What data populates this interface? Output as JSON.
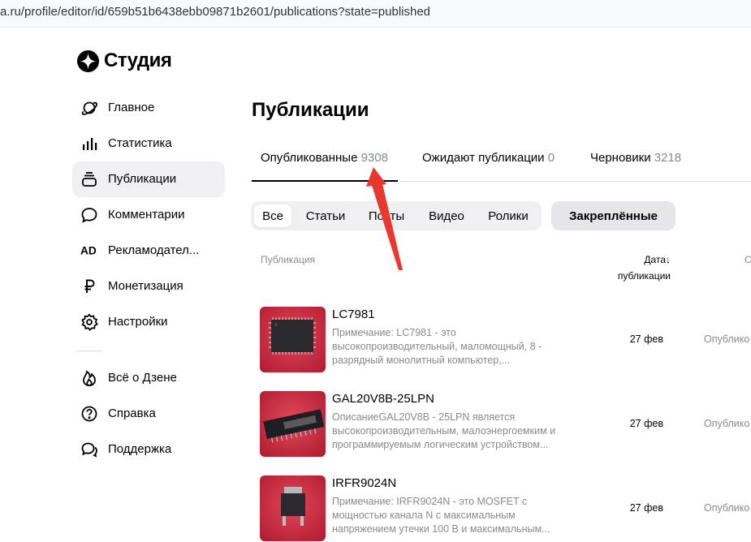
{
  "browser": {
    "url": "a.ru/profile/editor/id/659b51b6438ebb09871b2601/publications?state=published"
  },
  "brand": {
    "name": "Студия"
  },
  "sidebar": {
    "items": [
      {
        "label": "Главное",
        "icon": "planet-icon"
      },
      {
        "label": "Статистика",
        "icon": "bar-chart-icon"
      },
      {
        "label": "Публикации",
        "icon": "publications-icon",
        "active": true
      },
      {
        "label": "Комментарии",
        "icon": "comment-icon"
      },
      {
        "label": "Рекламодател...",
        "icon": "ad-icon"
      },
      {
        "label": "Монетизация",
        "icon": "ruble-icon"
      },
      {
        "label": "Настройки",
        "icon": "gear-icon"
      }
    ],
    "footer_items": [
      {
        "label": "Всё о Дзене",
        "icon": "flame-icon"
      },
      {
        "label": "Справка",
        "icon": "help-icon"
      },
      {
        "label": "Поддержка",
        "icon": "support-chat-icon"
      }
    ]
  },
  "page": {
    "title": "Публикации"
  },
  "tabs": [
    {
      "label": "Опубликованные",
      "count": "9308",
      "active": true
    },
    {
      "label": "Ожидают публикации",
      "count": "0"
    },
    {
      "label": "Черновики",
      "count": "3218"
    }
  ],
  "filters": {
    "types": [
      "Все",
      "Статьи",
      "Посты",
      "Видео",
      "Ролики"
    ],
    "selected": "Все",
    "pinned_label": "Закреплённые"
  },
  "table": {
    "col_publication": "Публикация",
    "col_date_line1": "Дата↓",
    "col_date_line2": "публикации",
    "col_status_partial": "С",
    "rows": [
      {
        "title": "LC7981",
        "desc": "Примечание: LC7981 - это высокопроизводительный, маломощный, 8 - разрядный монолитный компьютер,...",
        "date": "27 фев",
        "status": "Опублико"
      },
      {
        "title": "GAL20V8B-25LPN",
        "desc": "ОписаниеGAL20V8B - 25LPN является высокопроизводительным, малоэнергоемким и программируемым логическим устройством...",
        "date": "27 фев",
        "status": "Опублико"
      },
      {
        "title": "IRFR9024N",
        "desc": "Примечание: IRFR9024N - это MOSFET с мощностью канала N с максимальным напряжением утечки 100 В и максимальным...",
        "date": "27 фев",
        "status": "Опублико"
      }
    ]
  },
  "colors": {
    "accent": "#000000",
    "muted": "#8a8a8a",
    "active_bg": "#f0f0f2",
    "annotation": "#e8372c"
  }
}
